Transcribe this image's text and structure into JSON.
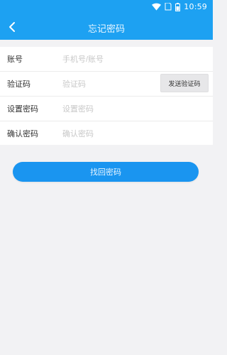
{
  "status_bar": {
    "time": "10:59"
  },
  "header": {
    "title": "忘记密码",
    "back_icon": "chevron-left-icon"
  },
  "form": {
    "account": {
      "label": "账号",
      "placeholder": "手机号/账号"
    },
    "code": {
      "label": "验证码",
      "placeholder": "验证码",
      "button_label": "发送验证码"
    },
    "password": {
      "label": "设置密码",
      "placeholder": "设置密码"
    },
    "confirm": {
      "label": "确认密码",
      "placeholder": "确认密码"
    }
  },
  "submit": {
    "label": "找回密码"
  },
  "colors": {
    "primary": "#1da1f2",
    "button": "#1a95f0",
    "background": "#f2f2f4"
  }
}
